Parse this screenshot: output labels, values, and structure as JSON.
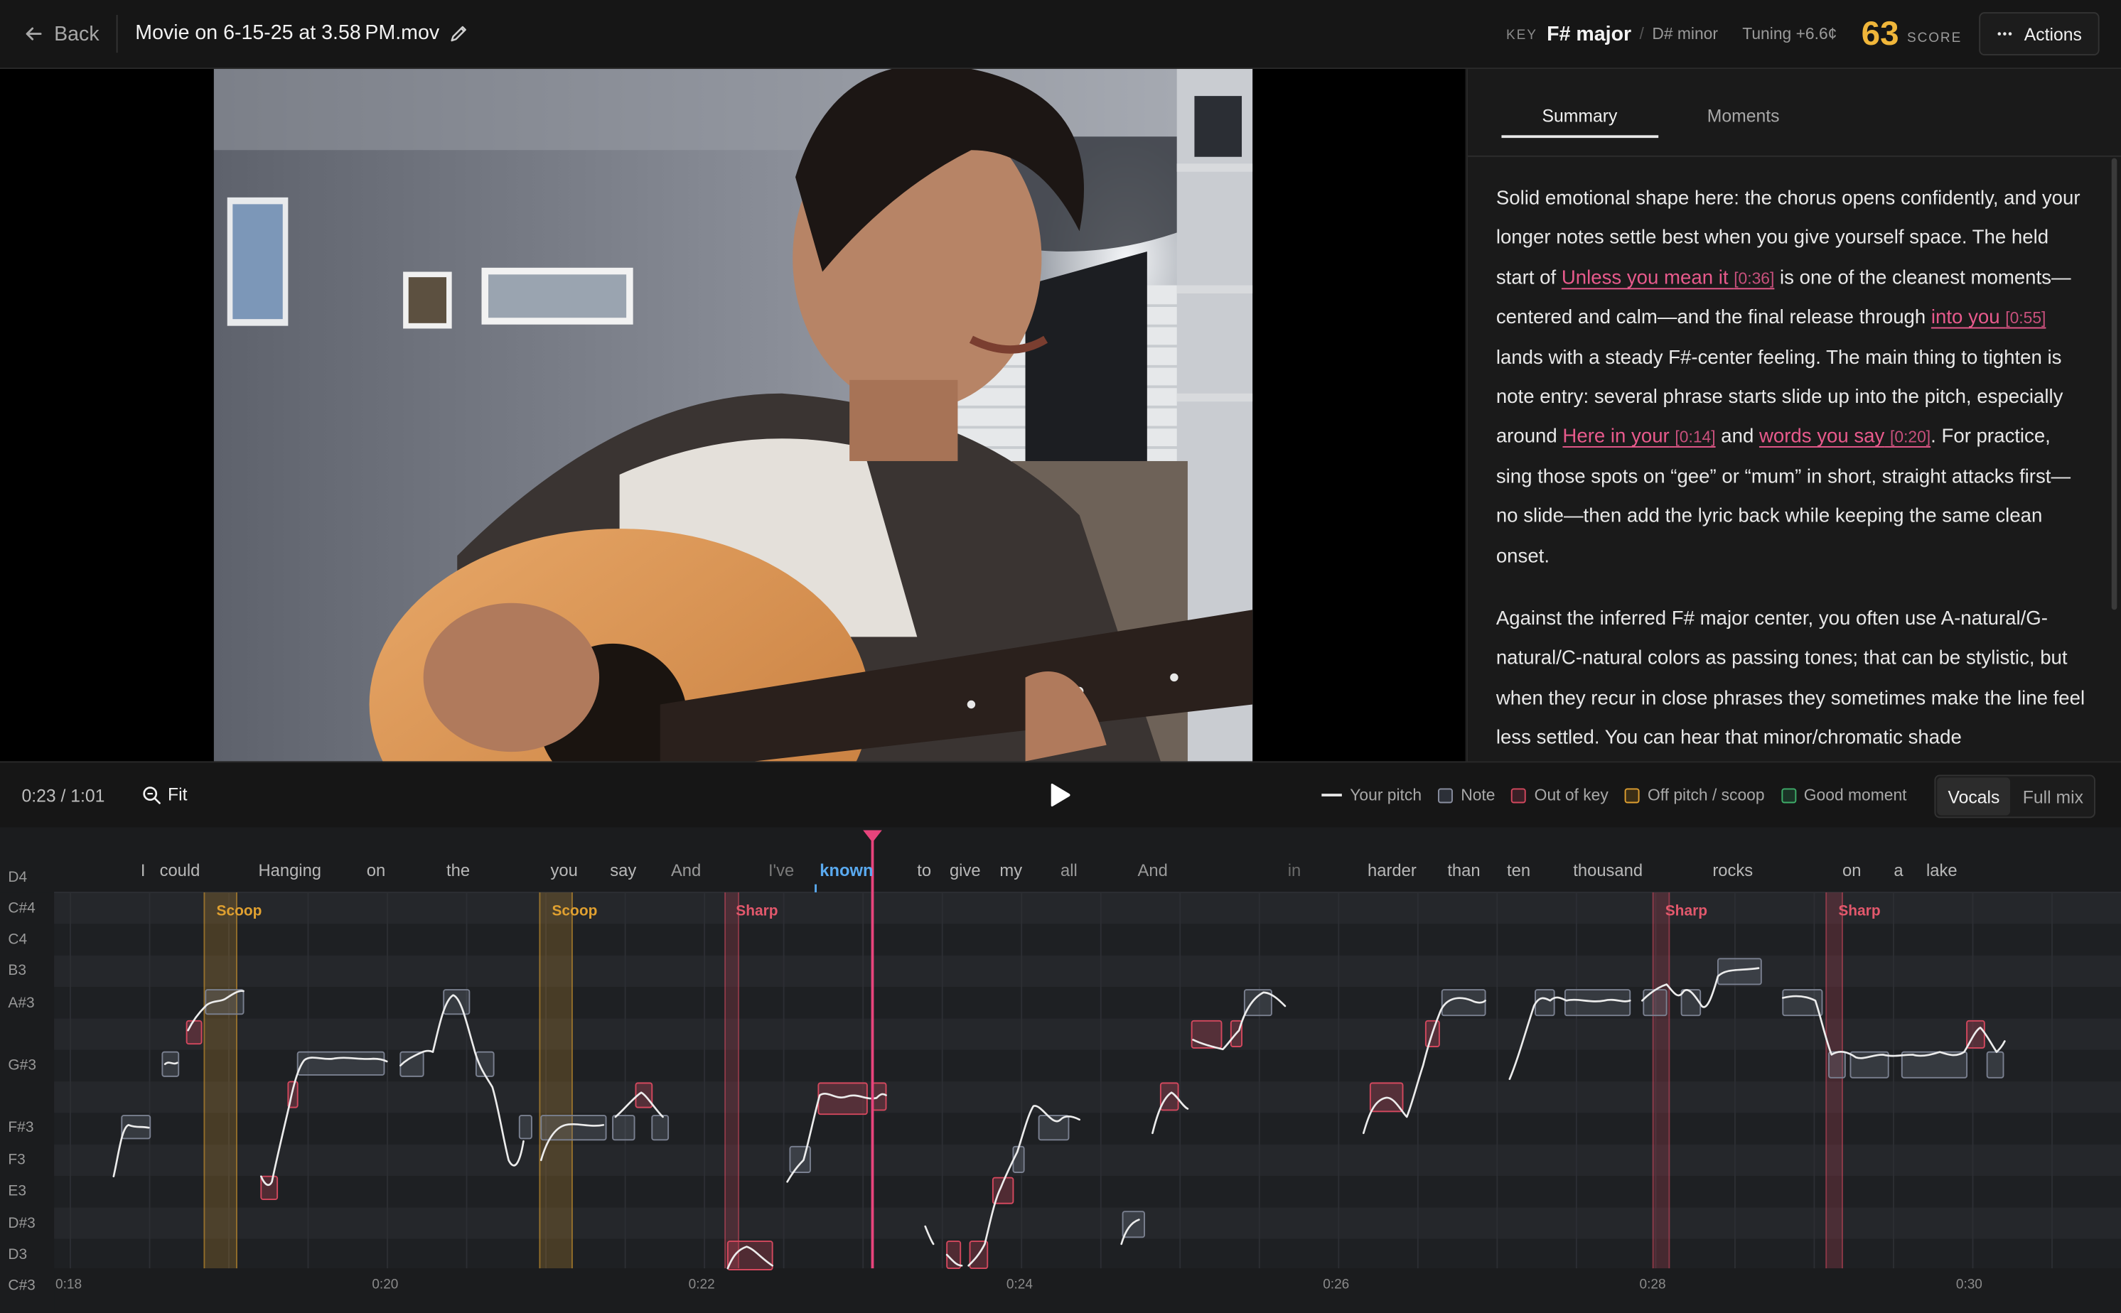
{
  "header": {
    "back_label": "Back",
    "title": "Movie on 6-15-25 at 3.58 PM.mov",
    "key_label": "KEY",
    "key_value": "F# major",
    "key_alt": "D# minor",
    "tuning": "Tuning +6.6¢",
    "score": "63",
    "score_label": "SCORE",
    "actions_label": "Actions"
  },
  "panel": {
    "tabs": [
      "Summary",
      "Moments"
    ],
    "active_tab": "Summary",
    "p1": {
      "t1": "Solid emotional shape here: the chorus opens confidently, and your longer notes settle best when you give yourself space. The held start of ",
      "l1": "Unless you mean it",
      "ts1": "[0:36]",
      "t2": " is one of the cleanest moments—centered and calm—and the final release through ",
      "l2": "into you",
      "ts2": "[0:55]",
      "t3": " lands with a steady F#-center feeling. The main thing to tighten is note entry: several phrase starts slide up into the pitch, especially around ",
      "l3": "Here in your",
      "ts3": "[0:14]",
      "t4": " and ",
      "l4": "words you say",
      "ts4": "[0:20]",
      "t5": ". For practice, sing those spots on “gee” or “mum” in short, straight attacks first—no slide—then add the lyric back while keeping the same clean onset."
    },
    "p2": "Against the inferred F# major center, you often use A-natural/G-natural/C-natural colors as passing tones; that can be stylistic, but when they recur in close phrases they sometimes make the line feel less settled. You can hear that minor/chromatic shade"
  },
  "transport": {
    "time": "0:23 / 1:01",
    "fit_label": "Fit",
    "legend": [
      {
        "label": "Your pitch",
        "color": "#e8e8e8",
        "kind": "line"
      },
      {
        "label": "Note",
        "color": "#8a8fa0",
        "kind": "box"
      },
      {
        "label": "Out of key",
        "color": "#d4485e",
        "kind": "box"
      },
      {
        "label": "Off pitch / scoop",
        "color": "#e0a030",
        "kind": "box"
      },
      {
        "label": "Good moment",
        "color": "#3fae6a",
        "kind": "box"
      }
    ],
    "mix_options": [
      "Vocals",
      "Full mix"
    ],
    "active_mix": "Vocals"
  },
  "roll": {
    "pitch_labels": [
      "D4",
      "C#4",
      "C4",
      "B3",
      "A#3",
      "G#3",
      "F#3",
      "F3",
      "E3",
      "D#3",
      "D3",
      "C#3"
    ],
    "time_labels": [
      "0:18",
      "0:20",
      "0:22",
      "0:24",
      "0:26",
      "0:28",
      "0:30"
    ],
    "lyrics": [
      "I",
      "could",
      "Hanging",
      "on",
      "the",
      "you",
      "say",
      "And",
      "I've",
      "known",
      "to",
      "give",
      "my",
      "all",
      "And",
      "in",
      "harder",
      "than",
      "ten",
      "thousand",
      "rocks",
      "on",
      "a",
      "lake"
    ],
    "active_lyric": "known",
    "markers": [
      {
        "label": "Scoop",
        "type": "scoop"
      },
      {
        "label": "Scoop",
        "type": "scoop"
      },
      {
        "label": "Sharp",
        "type": "sharp"
      },
      {
        "label": "Sharp",
        "type": "sharp"
      },
      {
        "label": "Sharp",
        "type": "sharp"
      }
    ],
    "playhead_time": "0:23"
  },
  "colors": {
    "accent_pink": "#e8447c",
    "score_gold": "#f0b63a",
    "scoop": "#e0a030",
    "sharp": "#d4485e",
    "active_lyric": "#5aaaf0"
  }
}
